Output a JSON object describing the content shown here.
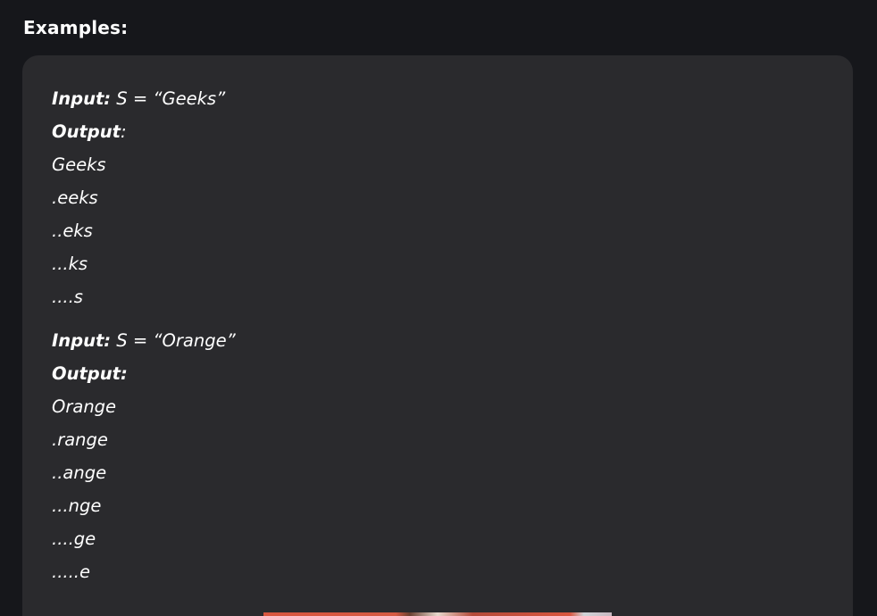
{
  "heading": "Examples:",
  "examples": [
    {
      "input_label": "Input:",
      "input_value": " S = “Geeks”",
      "output_label": "Output",
      "output_colon": ":",
      "lines": [
        "Geeks",
        ".eeks",
        "..eks",
        "...ks",
        "....s"
      ]
    },
    {
      "input_label": "Input:",
      "input_value": " S = “Orange”",
      "output_label": "Output:",
      "output_colon": "",
      "lines": [
        "Orange",
        ".range",
        "..ange",
        "...nge",
        "....ge",
        ".....e"
      ]
    }
  ]
}
